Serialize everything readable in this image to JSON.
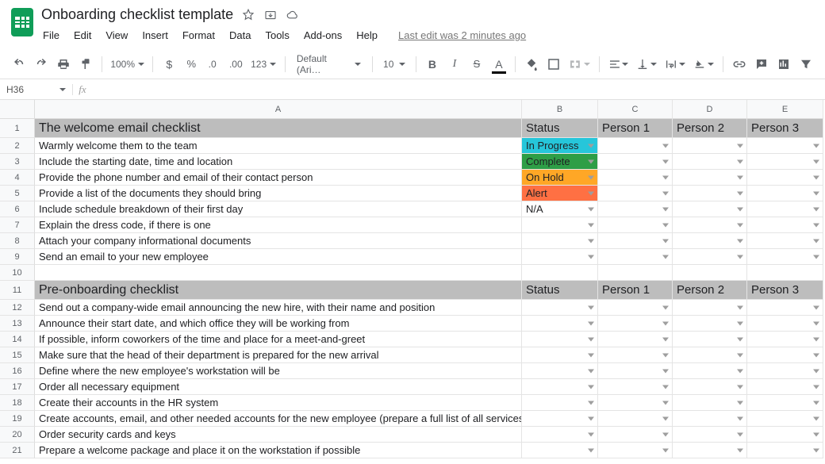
{
  "doc": {
    "title": "Onboarding checklist template"
  },
  "menus": [
    "File",
    "Edit",
    "View",
    "Insert",
    "Format",
    "Data",
    "Tools",
    "Add-ons",
    "Help"
  ],
  "last_edit": "Last edit was 2 minutes ago",
  "toolbar": {
    "zoom": "100%",
    "font": "Default (Ari…",
    "font_size": "10",
    "number_format": "123"
  },
  "namebox": "H36",
  "formula": "",
  "columns": [
    "A",
    "B",
    "C",
    "D",
    "E"
  ],
  "status_colors": {
    "In Progress": "#26c6da",
    "Complete": "#2e9e46",
    "On Hold": "#ffa726",
    "Alert": "#ff7043"
  },
  "rows": [
    {
      "n": 1,
      "section": true,
      "a": "The welcome email checklist",
      "b": "Status",
      "c": "Person 1",
      "d": "Person 2",
      "e": "Person 3"
    },
    {
      "n": 2,
      "a": "Warmly welcome them to the team",
      "b": "In Progress",
      "bclass": "status-inprogress",
      "dd": true
    },
    {
      "n": 3,
      "a": "Include the starting date, time and location",
      "b": "Complete",
      "bclass": "status-complete",
      "dd": true
    },
    {
      "n": 4,
      "a": "Provide the phone number and email of their contact person",
      "b": "On Hold",
      "bclass": "status-onhold",
      "dd": true
    },
    {
      "n": 5,
      "a": "Provide a list of the documents they should bring",
      "b": "Alert",
      "bclass": "status-alert",
      "dd": true
    },
    {
      "n": 6,
      "a": "Include schedule breakdown of their first day",
      "b": "N/A",
      "dd": true
    },
    {
      "n": 7,
      "a": "Explain the dress code, if there is one",
      "dd": true
    },
    {
      "n": 8,
      "a": "Attach your company informational documents",
      "dd": true
    },
    {
      "n": 9,
      "a": "Send an email to your new employee",
      "dd": true
    },
    {
      "n": 10,
      "a": ""
    },
    {
      "n": 11,
      "section": true,
      "a": "Pre-onboarding checklist",
      "b": "Status",
      "c": "Person 1",
      "d": "Person 2",
      "e": "Person 3"
    },
    {
      "n": 12,
      "a": "Send out a company-wide email announcing the new hire, with their name and position",
      "dd": true
    },
    {
      "n": 13,
      "a": "Announce their start date, and which office they will be working from",
      "dd": true
    },
    {
      "n": 14,
      "a": "If possible, inform coworkers of the time and place for a meet-and-greet",
      "dd": true
    },
    {
      "n": 15,
      "a": "Make sure that the head of their department is prepared for the new arrival",
      "dd": true
    },
    {
      "n": 16,
      "a": "Define where the new employee's workstation will be",
      "dd": true
    },
    {
      "n": 17,
      "a": "Order all necessary equipment",
      "dd": true
    },
    {
      "n": 18,
      "a": "Create their accounts in the HR system",
      "dd": true
    },
    {
      "n": 19,
      "a": "Create accounts, email, and other needed accounts for the new employee (prepare a full list of all services)",
      "dd": true
    },
    {
      "n": 20,
      "a": "Order security cards and keys",
      "dd": true
    },
    {
      "n": 21,
      "a": "Prepare a welcome package and place it on the workstation if possible",
      "dd": true
    }
  ]
}
